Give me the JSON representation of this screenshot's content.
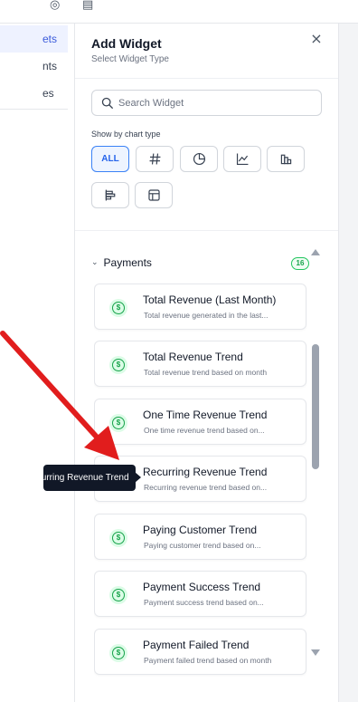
{
  "topbar": {
    "icons": [
      "cloud-icon",
      "document-icon"
    ]
  },
  "left_nav": {
    "items": [
      {
        "label": "ets",
        "active": true
      },
      {
        "label": "nts",
        "active": false
      },
      {
        "label": "es",
        "active": false
      }
    ]
  },
  "panel": {
    "title": "Add Widget",
    "subtitle": "Select Widget Type",
    "close_icon": "close-icon",
    "search": {
      "placeholder": "Search Widget",
      "value": ""
    },
    "show_by_label": "Show by chart type",
    "chart_types": [
      {
        "label": "ALL",
        "icon": "",
        "active": true
      },
      {
        "label": "",
        "icon": "hash-icon",
        "active": false
      },
      {
        "label": "",
        "icon": "pie-chart-icon",
        "active": false
      },
      {
        "label": "",
        "icon": "line-chart-icon",
        "active": false
      },
      {
        "label": "",
        "icon": "bar-chart-icon",
        "active": false
      },
      {
        "label": "",
        "icon": "horizontal-bar-chart-icon",
        "active": false
      },
      {
        "label": "",
        "icon": "table-icon",
        "active": false
      }
    ],
    "group": {
      "name": "Payments",
      "count": "16",
      "widgets": [
        {
          "title": "Total Revenue (Last Month)",
          "desc": "Total revenue generated in the last..."
        },
        {
          "title": "Total Revenue Trend",
          "desc": "Total revenue trend based on month"
        },
        {
          "title": "One Time Revenue Trend",
          "desc": "One time revenue trend based on..."
        },
        {
          "title": "Recurring Revenue Trend",
          "desc": "Recurring revenue trend based on..."
        },
        {
          "title": "Paying Customer Trend",
          "desc": "Paying customer trend based on..."
        },
        {
          "title": "Payment Success Trend",
          "desc": "Payment success trend based on..."
        },
        {
          "title": "Payment Failed Trend",
          "desc": "Payment failed trend based on month"
        }
      ]
    }
  },
  "tooltip": {
    "text": "Recurring Revenue Trend"
  },
  "colors": {
    "accent": "#2563eb",
    "success": "#16a34a",
    "annotation_arrow": "#e11d1d"
  }
}
